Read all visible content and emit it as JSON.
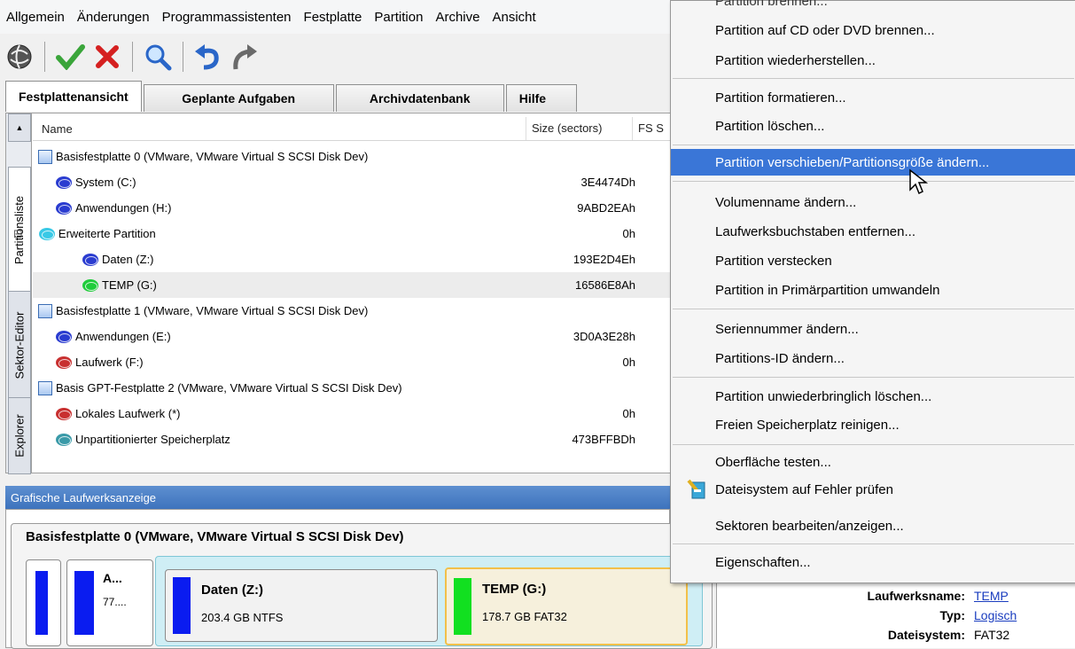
{
  "menubar": {
    "items": [
      "Allgemein",
      "Änderungen",
      "Programmassistenten",
      "Festplatte",
      "Partition",
      "Archive",
      "Ansicht"
    ]
  },
  "toolbar": {
    "icons": [
      "globe-icon",
      "check-icon",
      "cross-icon",
      "magnifier-icon",
      "undo-icon",
      "redo-icon"
    ]
  },
  "tabs": [
    "Festplattenansicht",
    "Geplante Aufgaben",
    "Archivdatenbank",
    "Hilfe"
  ],
  "vtabs": [
    "Partitionsliste",
    "Sektor-Editor",
    "Explorer"
  ],
  "columns": {
    "name": "Name",
    "size": "Size (sectors)",
    "fs": "FS S"
  },
  "tree": [
    {
      "type": "disk",
      "name": "Basisfestplatte 0 (VMware, VMware Virtual S SCSI Disk Dev)",
      "size": ""
    },
    {
      "type": "part",
      "color": "#2a3cd0",
      "name": "System (C:)",
      "size": "3E4474Dh"
    },
    {
      "type": "part",
      "color": "#2a3cd0",
      "name": "Anwendungen (H:)",
      "size": "9ABD2EAh"
    },
    {
      "type": "part",
      "color": "#39c9e6",
      "name": "Erweiterte Partition",
      "size": "0h"
    },
    {
      "type": "part",
      "color": "#2a3cd0",
      "name": "Daten (Z:)",
      "size": "193E2D4Eh"
    },
    {
      "type": "part",
      "color": "#1fcc3a",
      "name": "TEMP (G:)",
      "size": "16586E8Ah"
    },
    {
      "type": "disk",
      "name": "Basisfestplatte 1 (VMware, VMware Virtual S SCSI Disk Dev)",
      "size": ""
    },
    {
      "type": "part",
      "color": "#2a3cd0",
      "name": "Anwendungen (E:)",
      "size": "3D0A3E28h"
    },
    {
      "type": "part",
      "color": "#c83030",
      "name": "Laufwerk (F:)",
      "size": "0h"
    },
    {
      "type": "disk",
      "name": "Basis GPT-Festplatte 2 (VMware, VMware Virtual S SCSI Disk Dev)",
      "size": ""
    },
    {
      "type": "part",
      "color": "#c83030",
      "name": "Lokales Laufwerk (*)",
      "size": "0h"
    },
    {
      "type": "part",
      "color": "#3a9aa8",
      "name": "Unpartitionierter Speicherplatz",
      "size": "473BFFBDh"
    }
  ],
  "graphic": {
    "header": "Grafische Laufwerksanzeige",
    "disk_title": "Basisfestplatte 0 (VMware, VMware Virtual S SCSI Disk Dev)",
    "small_a": "A...",
    "small_b": "77....",
    "daten_name": "Daten (Z:)",
    "daten_info": "203.4 GB NTFS",
    "temp_name": "TEMP (G:)",
    "temp_info": "178.7 GB FAT32"
  },
  "context_menu": {
    "items": [
      "Partition auf CD oder DVD brennen...",
      "Partition wiederherstellen...",
      "Partition formatieren...",
      "Partition löschen...",
      "Partition verschieben/Partitionsgröße ändern...",
      "Volumenname ändern...",
      "Laufwerksbuchstaben entfernen...",
      "Partition verstecken",
      "Partition in Primärpartition umwandeln",
      "Seriennummer ändern...",
      "Partitions-ID ändern...",
      "Partition unwiederbringlich löschen...",
      "Freien Speicherplatz reinigen...",
      "Oberfläche testen...",
      "Dateisystem auf Fehler prüfen",
      "Sektoren bearbeiten/anzeigen...",
      "Eigenschaften..."
    ]
  },
  "properties": {
    "label_name": "Laufwerksname:",
    "value_name": "TEMP",
    "label_type": "Typ:",
    "value_type": "Logisch",
    "label_fs": "Dateisystem:",
    "value_fs": "FAT32"
  },
  "colors": {
    "highlight": "#3a76d7",
    "blue": "#0a1cf0",
    "green": "#12e020"
  }
}
